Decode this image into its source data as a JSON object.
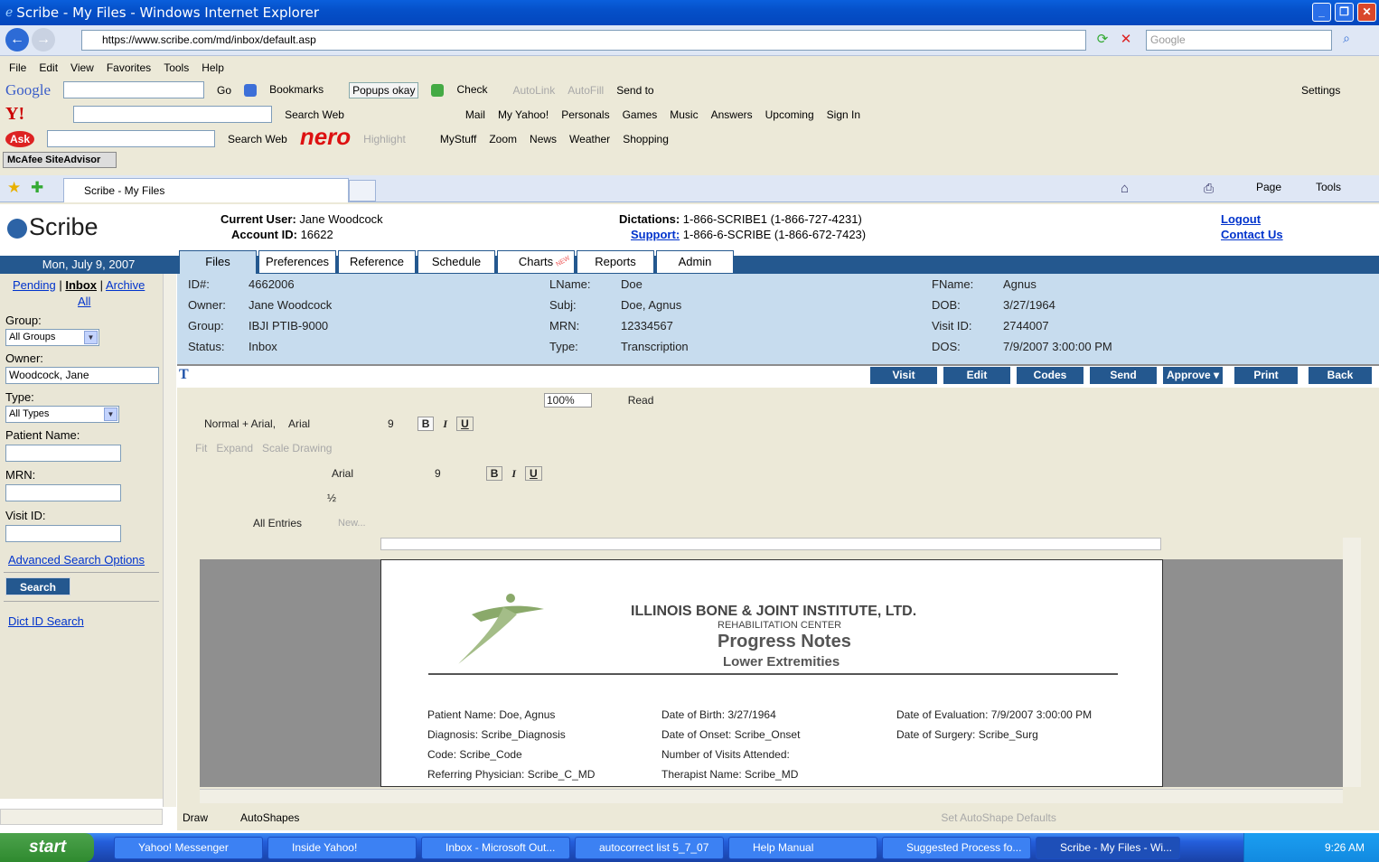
{
  "window": {
    "title": "Scribe - My Files - Windows Internet Explorer"
  },
  "address": {
    "url": "https://www.scribe.com/md/inbox/default.asp",
    "search_placeholder": "Google"
  },
  "menu": [
    "File",
    "Edit",
    "View",
    "Favorites",
    "Tools",
    "Help"
  ],
  "google_toolbar": {
    "brand": "Google",
    "go": "Go",
    "bookmarks": "Bookmarks",
    "popups": "Popups okay",
    "check": "Check",
    "autolink": "AutoLink",
    "autofill": "AutoFill",
    "send_to": "Send to",
    "settings": "Settings"
  },
  "yahoo_toolbar": {
    "brand": "Y!",
    "search_web": "Search Web",
    "mail": "Mail",
    "my_yahoo": "My Yahoo!",
    "personals": "Personals",
    "games": "Games",
    "music": "Music",
    "answers": "Answers",
    "upcoming": "Upcoming",
    "sign_in": "Sign In"
  },
  "ask_toolbar": {
    "brand": "Ask",
    "search_web": "Search Web",
    "nero": "nero",
    "highlight": "Highlight",
    "mystuff": "MyStuff",
    "zoom": "Zoom",
    "news": "News",
    "weather": "Weather",
    "shopping": "Shopping"
  },
  "mcafee": "McAfee SiteAdvisor",
  "browser_tab": {
    "label": "Scribe - My Files",
    "page": "Page",
    "tools": "Tools"
  },
  "header": {
    "logo": "Scribe",
    "current_user_label": "Current User:",
    "current_user": "Jane Woodcock",
    "account_label": "Account ID:",
    "account_id": "16622",
    "dictations_label": "Dictations:",
    "dictations": "1-866-SCRIBE1 (1-866-727-4231)",
    "support_label": "Support:",
    "support": "1-866-6-SCRIBE (1-866-672-7423)",
    "logout": "Logout",
    "contact": "Contact Us"
  },
  "date": "Mon, July 9, 2007",
  "tabs": [
    "Files",
    "Preferences",
    "Reference",
    "Schedule",
    "Charts",
    "Reports",
    "Admin"
  ],
  "charts_badge": "NEW",
  "sidebar": {
    "pending": "Pending",
    "sep": "|",
    "inbox": "Inbox",
    "archive": "Archive",
    "all": "All",
    "group_label": "Group:",
    "group_value": "All Groups",
    "owner_label": "Owner:",
    "owner_value": "Woodcock, Jane",
    "type_label": "Type:",
    "type_value": "All Types",
    "patient_label": "Patient Name:",
    "mrn_label": "MRN:",
    "visit_label": "Visit ID:",
    "advanced": "Advanced Search Options",
    "search": "Search",
    "dict_search": "Dict ID Search"
  },
  "info": {
    "id_label": "ID#:",
    "id": "4662006",
    "owner_label": "Owner:",
    "owner": "Jane Woodcock",
    "group_label": "Group:",
    "group": "IBJI PTIB-9000",
    "status_label": "Status:",
    "status": "Inbox",
    "lname_label": "LName:",
    "lname": "Doe",
    "subj_label": "Subj:",
    "subj": "Doe, Agnus",
    "mrn_label": "MRN:",
    "mrn": "12334567",
    "type_label": "Type:",
    "type": "Transcription",
    "fname_label": "FName:",
    "fname": "Agnus",
    "dob_label": "DOB:",
    "dob": "3/27/1964",
    "visit_label": "Visit ID:",
    "visit": "2744007",
    "dos_label": "DOS:",
    "dos": "7/9/2007 3:00:00 PM"
  },
  "actions": [
    "Visit",
    "Edit",
    "Codes",
    "Send",
    "Approve ▾",
    "Print",
    "Back"
  ],
  "word": {
    "zoom": "100%",
    "read": "Read",
    "style": "Normal + Arial,",
    "font": "Arial",
    "size": "9",
    "fit": "Fit",
    "expand": "Expand",
    "scale": "Scale Drawing",
    "font2": "Arial",
    "size2": "9",
    "line_w": "½",
    "entries": "All Entries",
    "new": "New...",
    "draw": "Draw",
    "autoshapes": "AutoShapes",
    "set_defaults": "Set AutoShape Defaults"
  },
  "doc": {
    "org": "ILLINOIS BONE & JOINT INSTITUTE, LTD.",
    "center": "REHABILITATION CENTER",
    "title": "Progress Notes",
    "subtitle": "Lower Extremities",
    "patient": "Patient Name: Doe, Agnus",
    "diagnosis": "Diagnosis:  Scribe_Diagnosis",
    "code": "Code:  Scribe_Code",
    "referring": "Referring Physician:  Scribe_C_MD",
    "dob": "Date of Birth:        3/27/1964",
    "onset": "Date of Onset: Scribe_Onset",
    "visits": "Number of Visits Attended:",
    "therapist": "Therapist Name:  Scribe_MD",
    "evaluation": "Date of Evaluation:  7/9/2007 3:00:00 PM",
    "surgery": "Date of Surgery:  Scribe_Surg"
  },
  "taskbar": {
    "start": "start",
    "tasks": [
      "Yahoo! Messenger",
      "Inside Yahoo!",
      "Inbox - Microsoft Out...",
      "autocorrect list 5_7_07",
      "Help Manual",
      "Suggested Process fo...",
      "Scribe - My Files - Wi..."
    ],
    "time": "9:26 AM"
  }
}
